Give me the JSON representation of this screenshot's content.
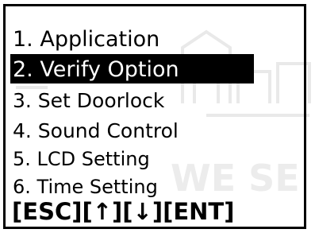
{
  "menu": {
    "items": [
      {
        "label": "1. Application"
      },
      {
        "label": "2. Verify Option"
      },
      {
        "label": "3. Set Doorlock"
      },
      {
        "label": "4. Sound Control"
      },
      {
        "label": "5. LCD Setting"
      },
      {
        "label": "6. Time Setting"
      }
    ],
    "selected_index": 1
  },
  "footer": {
    "keys": "[ESC][↑][↓][ENT]"
  },
  "watermark": {
    "text": "WE SE"
  }
}
